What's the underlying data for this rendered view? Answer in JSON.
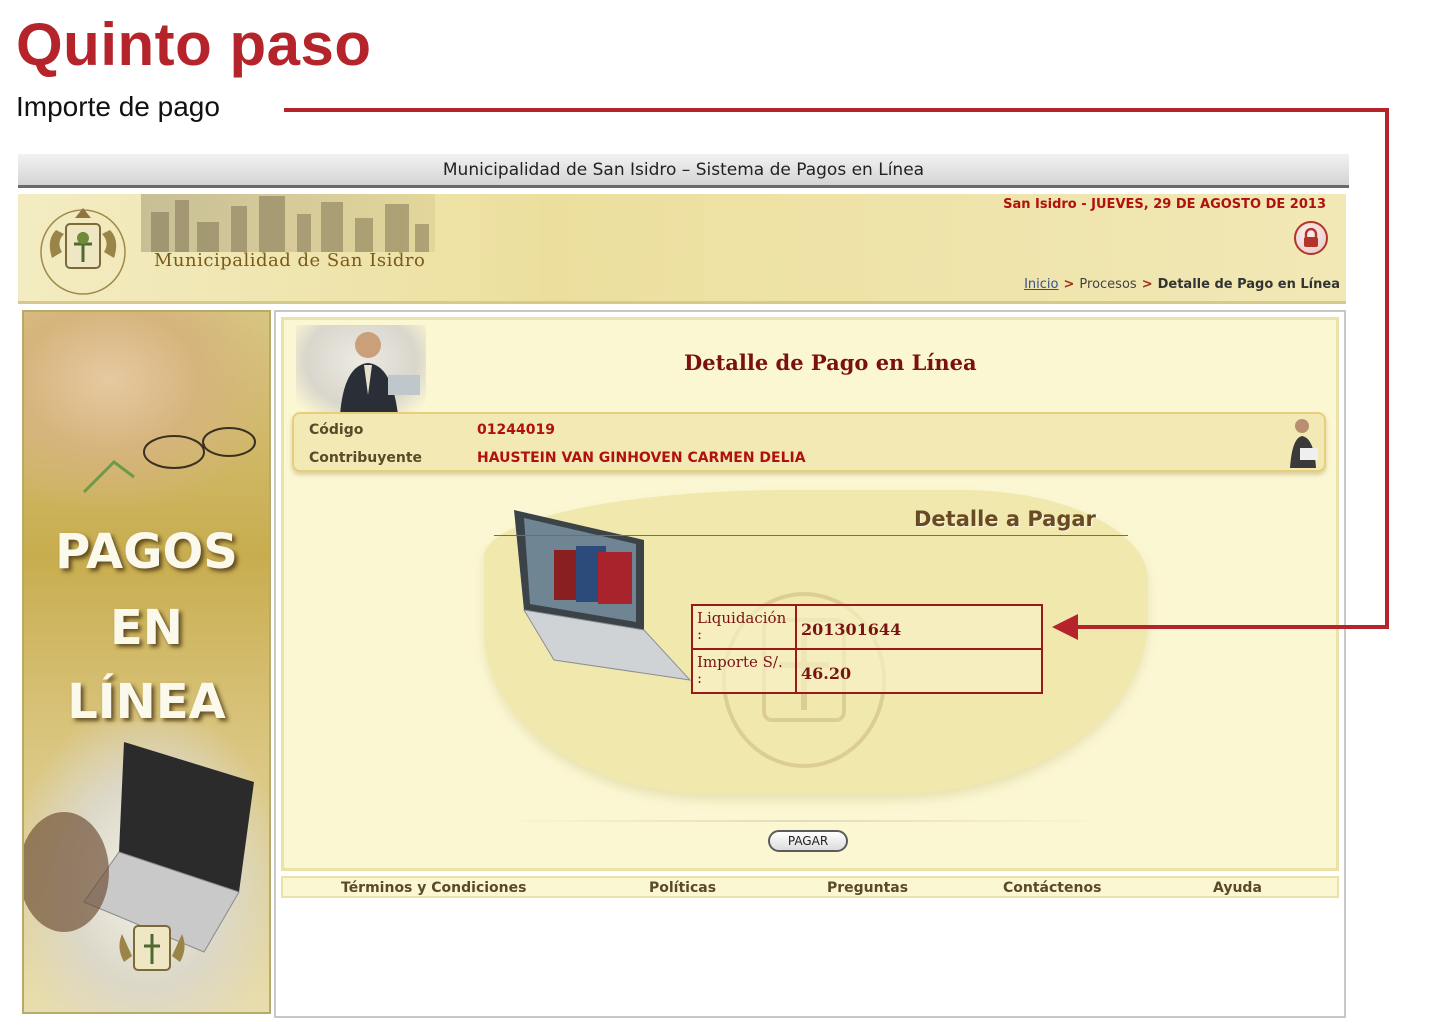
{
  "annotation": {
    "title": "Quinto paso",
    "subtitle": "Importe de pago",
    "accent_color": "#b5242a"
  },
  "window": {
    "title": "Municipalidad de San Isidro – Sistema de Pagos en Línea"
  },
  "header": {
    "org_name": "Municipalidad de San Isidro",
    "date_line": "San Isidro - JUEVES, 29 DE AGOSTO DE 2013",
    "lock_icon": "lock-icon",
    "breadcrumb": {
      "home": "Inicio",
      "separator": ">",
      "process": "Procesos",
      "current": "Detalle de Pago en Línea"
    }
  },
  "sidebar": {
    "line1": "PAGOS",
    "line2": "EN",
    "line3": "LÍNEA"
  },
  "main": {
    "heading": "Detalle de Pago en Línea",
    "info": {
      "code_label": "Código",
      "code_value": "01244019",
      "taxpayer_label": "Contribuyente",
      "taxpayer_value": "HAUSTEIN VAN GINHOVEN CARMEN DELIA"
    },
    "detail": {
      "heading": "Detalle a Pagar",
      "rows": [
        {
          "label": "Liquidación :",
          "value": "201301644"
        },
        {
          "label": "Importe S/. :",
          "value": "46.20"
        }
      ]
    },
    "pay_button": "PAGAR"
  },
  "footer": {
    "links": [
      "Términos y Condiciones",
      "Políticas",
      "Preguntas",
      "Contáctenos",
      "Ayuda"
    ]
  },
  "colors": {
    "brand_red": "#b01010",
    "panel_bg": "#fbf7d3",
    "header_gold": "#ecdf9e",
    "table_border": "#9a1a1a"
  }
}
